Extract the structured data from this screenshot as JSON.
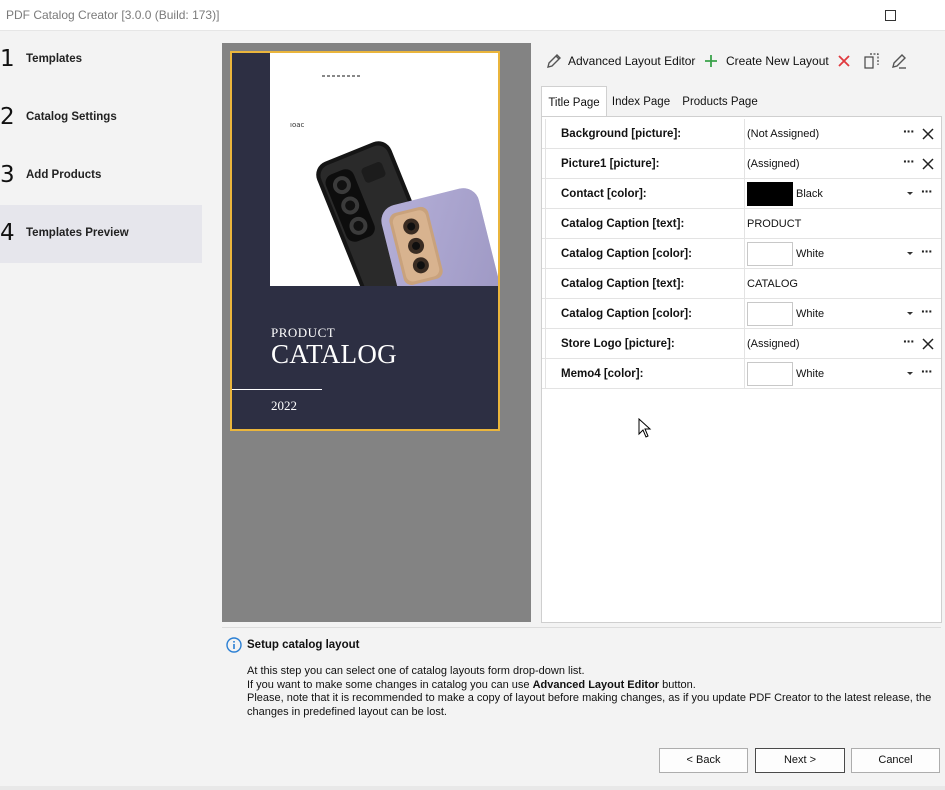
{
  "window": {
    "title": "PDF Catalog Creator [3.0.0 (Build: 173)]"
  },
  "steps": [
    {
      "num": "1",
      "label": "Templates"
    },
    {
      "num": "2",
      "label": "Catalog Settings"
    },
    {
      "num": "3",
      "label": "Add Products"
    },
    {
      "num": "4",
      "label": "Templates Preview",
      "active": true
    }
  ],
  "preview": {
    "logo_text": "ıoac",
    "caption1": "PRODUCT",
    "caption2": "CATALOG",
    "year": "2022"
  },
  "toolbar": {
    "advanced": "Advanced Layout Editor",
    "create": "Create New Layout"
  },
  "tabs": [
    "Title Page",
    "Index Page",
    "Products Page"
  ],
  "properties": [
    {
      "name": "Background [picture]:",
      "value": "(Not Assigned)",
      "kind": "picture"
    },
    {
      "name": "Picture1 [picture]:",
      "value": "(Assigned)",
      "kind": "picture"
    },
    {
      "name": "Contact [color]:",
      "value": "Black",
      "kind": "color",
      "color": "#000000"
    },
    {
      "name": "Catalog Caption [text]:",
      "value": "PRODUCT",
      "kind": "text"
    },
    {
      "name": "Catalog Caption [color]:",
      "value": "White",
      "kind": "color",
      "color": "#ffffff"
    },
    {
      "name": "Catalog Caption [text]:",
      "value": "CATALOG",
      "kind": "text"
    },
    {
      "name": "Catalog Caption [color]:",
      "value": "White",
      "kind": "color",
      "color": "#ffffff"
    },
    {
      "name": "Store Logo [picture]:",
      "value": "(Assigned)",
      "kind": "picture"
    },
    {
      "name": "Memo4 [color]:",
      "value": "White",
      "kind": "color",
      "color": "#ffffff"
    }
  ],
  "info": {
    "title": "Setup catalog layout",
    "line1": "At this step you can select one of catalog layouts form drop-down list.",
    "line2_pre": "If you want to make some changes in catalog you can use ",
    "line2_bold": "Advanced Layout Editor",
    "line2_post": " button.",
    "line3": "Please, note that it is recommended to make a copy of layout before making changes, as if you update PDF Creator to the latest release, the changes in predefined layout can be lost."
  },
  "buttons": {
    "back": "< Back",
    "next": "Next >",
    "cancel": "Cancel"
  },
  "colors": {
    "accent_border": "#eab53c",
    "cover_bg": "#2d2f43",
    "create_plus": "#3aa24a",
    "delete_x": "#e0393e",
    "info_icon": "#2a7fd4"
  }
}
